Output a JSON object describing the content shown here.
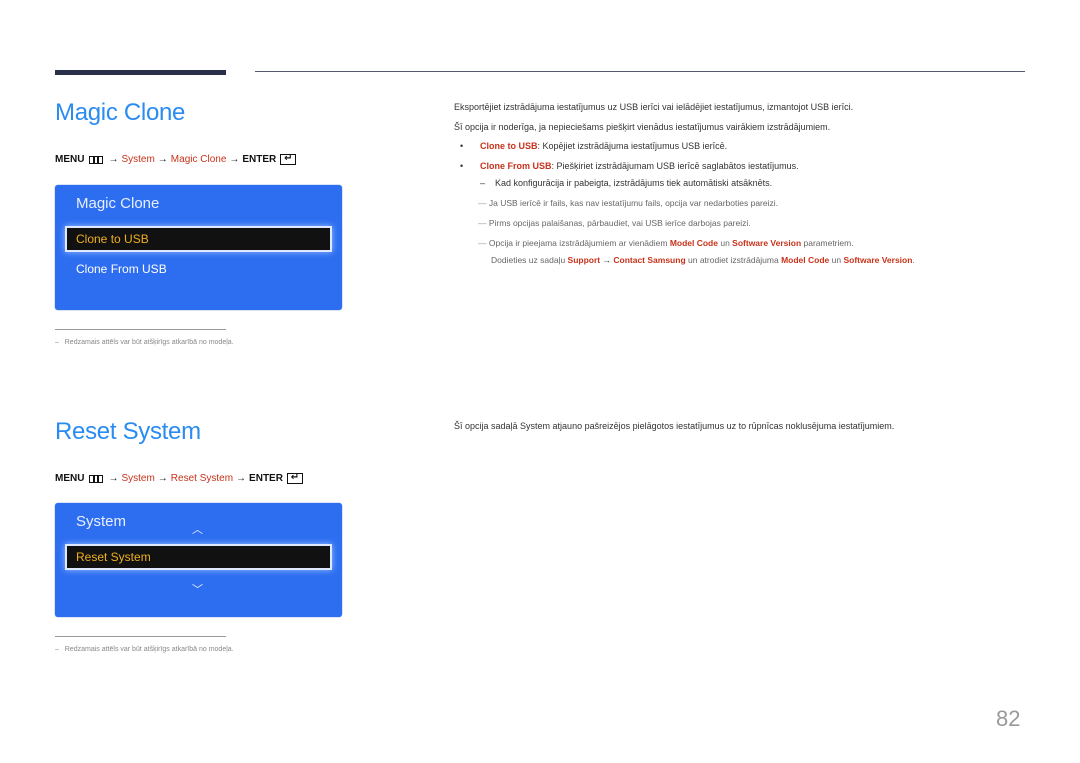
{
  "page_number": "82",
  "magic_clone": {
    "title": "Magic Clone",
    "menu_path": {
      "menu": "MENU",
      "arrow": "→",
      "system": "System",
      "item": "Magic Clone",
      "enter": "ENTER",
      "enter_glyph": "↵"
    },
    "osd": {
      "title": "Magic Clone",
      "items": [
        {
          "label": "Clone to USB",
          "selected": true
        },
        {
          "label": "Clone From USB",
          "selected": false
        }
      ]
    },
    "footnote": {
      "dash": "–",
      "text": "Redzamais attēls var būt atšķirīgs atkarībā no modeļa."
    },
    "description": [
      "Eksportējiet izstrādājuma iestatījumus uz USB ierīci vai ielādējiet iestatījumus, izmantojot USB ierīci.",
      "Šī opcija ir noderīga, ja nepieciešams piešķirt vienādus iestatījumus vairākiem izstrādājumiem."
    ],
    "bullets": [
      {
        "term": "Clone to USB",
        "text": ": Kopējiet izstrādājuma iestatījumus USB ierīcē."
      },
      {
        "term": "Clone From USB",
        "text": ": Piešķiriet izstrādājumam USB ierīcē saglabātos iestatījumus."
      }
    ],
    "sub_note": {
      "dash": "–",
      "text": "Kad konfigurācija ir pabeigta, izstrādājums tiek automātiski atsāknēts."
    },
    "notes": [
      "Ja USB ierīcē ir fails, kas nav iestatījumu fails, opcija var nedarboties pareizi.",
      "Pirms opcijas palaišanas, pārbaudiet, vai USB ierīce darbojas pareizi."
    ],
    "note3": {
      "pre": "Opcija ir pieejama izstrādājumiem ar vienādiem ",
      "model_code": "Model Code",
      "un": " un ",
      "software_version": "Software Version",
      "post": " parametriem.",
      "line2_pre": "Dodieties uz sadaļu ",
      "support": "Support",
      "arrow": "→",
      "contact": "Contact Samsung",
      "line2_mid": " un atrodiet izstrādājuma ",
      "model_code2": "Model Code",
      "un2": " un ",
      "software_version2": "Software Version",
      "end": "."
    }
  },
  "reset_system": {
    "title": "Reset System",
    "menu_path": {
      "menu": "MENU",
      "arrow": "→",
      "system": "System",
      "item": "Reset System",
      "enter": "ENTER",
      "enter_glyph": "↵"
    },
    "osd": {
      "title": "System",
      "up_glyph": "︿",
      "down_glyph": "﹀",
      "items": [
        {
          "label": "Reset System",
          "selected": true
        }
      ]
    },
    "footnote": {
      "dash": "–",
      "text": "Redzamais attēls var būt atšķirīgs atkarībā no modeļa."
    },
    "description": "Šī opcija sadaļā System atjauno pašreizējos pielāgotos iestatījumus uz to rūpnīcas noklusējuma iestatījumiem."
  },
  "colors": {
    "title_blue": "#2a8bf0",
    "accent_red": "#c8321a",
    "osd_blue": "#2d6ef0",
    "osd_selected_text": "#f0b020"
  }
}
